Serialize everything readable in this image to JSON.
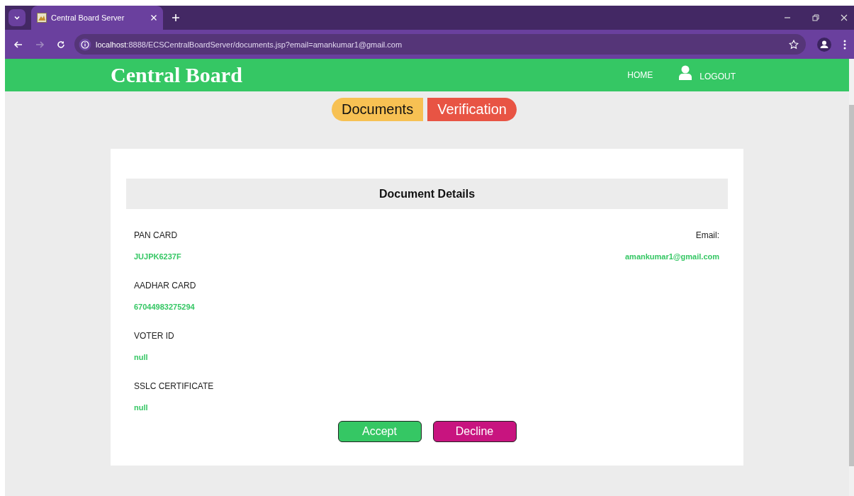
{
  "browser": {
    "tab_title": "Central Board Server",
    "url_host": "localhost",
    "url_rest": ":8888/ECSCentralBoardServer/documents.jsp?email=amankumar1@gmail.com"
  },
  "header": {
    "brand": "Central Board",
    "nav": [
      {
        "label": "HOME",
        "kind": "text"
      },
      {
        "label": "LOGOUT",
        "kind": "user"
      }
    ]
  },
  "tabs": [
    {
      "label": "Documents",
      "color": "#f7c153"
    },
    {
      "label": "Verification",
      "color": "#e85444"
    }
  ],
  "card": {
    "title": "Document Details",
    "fields": [
      {
        "label": "PAN CARD",
        "value": "JUJPK6237F"
      },
      {
        "label": "AADHAR CARD",
        "value": "67044983275294"
      },
      {
        "label": "VOTER ID",
        "value": "null"
      },
      {
        "label": "SSLC CERTIFICATE",
        "value": "null"
      }
    ],
    "email": {
      "label": "Email:",
      "value": "amankumar1@gmail.com"
    },
    "buttons": [
      {
        "label": "Accept",
        "kind": "accept"
      },
      {
        "label": "Decline",
        "kind": "decline"
      }
    ]
  }
}
